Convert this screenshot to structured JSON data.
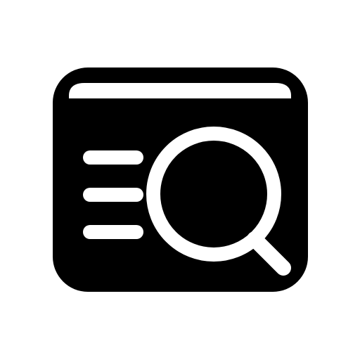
{
  "icon": {
    "name": "browser-search-icon",
    "description_label": "",
    "colors": {
      "background": "#ffffff",
      "foreground": "#000000",
      "cutout": "#ffffff"
    },
    "parts": {
      "frame": "window-frame-icon",
      "title_bar": "title-bar-icon",
      "text_lines": "text-lines-icon",
      "magnifier": "magnifying-glass-icon"
    },
    "text_line_count": 3
  }
}
